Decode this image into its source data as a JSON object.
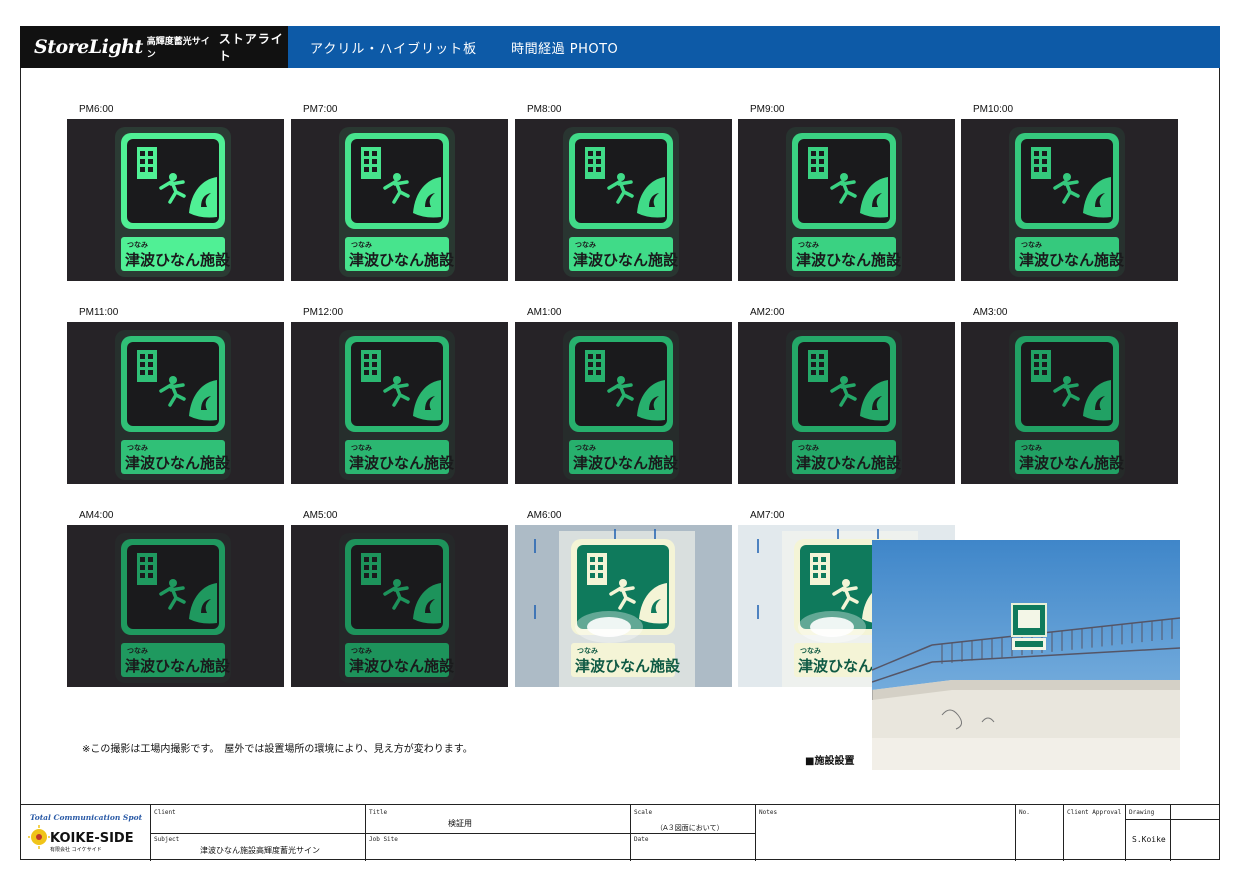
{
  "header": {
    "logo_en": "StoreLight",
    "logo_sub": "高輝度蓄光サイン",
    "logo_kana": "ストアライト",
    "title": "アクリル・ハイブリット板",
    "subtitle": "時間経過 PHOTO"
  },
  "sign": {
    "furigana": "つなみ",
    "text": "津波ひなん施設"
  },
  "photos": [
    {
      "label": "PM6:00",
      "brightness": 1.0,
      "scene": "night"
    },
    {
      "label": "PM7:00",
      "brightness": 0.92,
      "scene": "night"
    },
    {
      "label": "PM8:00",
      "brightness": 0.86,
      "scene": "night"
    },
    {
      "label": "PM9:00",
      "brightness": 0.8,
      "scene": "night"
    },
    {
      "label": "PM10:00",
      "brightness": 0.74,
      "scene": "night"
    },
    {
      "label": "PM11:00",
      "brightness": 0.68,
      "scene": "night"
    },
    {
      "label": "PM12:00",
      "brightness": 0.62,
      "scene": "night"
    },
    {
      "label": "AM1:00",
      "brightness": 0.57,
      "scene": "night"
    },
    {
      "label": "AM2:00",
      "brightness": 0.52,
      "scene": "night"
    },
    {
      "label": "AM3:00",
      "brightness": 0.47,
      "scene": "night"
    },
    {
      "label": "AM4:00",
      "brightness": 0.42,
      "scene": "night"
    },
    {
      "label": "AM5:00",
      "brightness": 0.38,
      "scene": "night"
    },
    {
      "label": "AM6:00",
      "brightness": 1.0,
      "scene": "day"
    },
    {
      "label": "AM7:00",
      "brightness": 1.0,
      "scene": "day-bright"
    }
  ],
  "note": "※この撮影は工場内撮影です。　屋外では設置場所の環境により、見え方が変わります。",
  "install_label": "■施設設置",
  "title_block": {
    "company_script": "Total Communication Spot",
    "company_name": "KOIKE-SIDE",
    "company_sub": "有限会社 コイケサイド",
    "client_label": "Client",
    "client_value": "",
    "title_label": "Title",
    "title_value": "検証用",
    "scale_label": "Scale",
    "scale_value": "（A３図面において）",
    "notes_label": "Notes",
    "no_label": "No.",
    "client_approval_label": "Client Approval",
    "drawing_label": "Drawing",
    "subject_label": "Subject",
    "subject_value": "津波ひなん施設高輝度蓄光サイン",
    "jobsite_label": "Job Site",
    "date_label": "Date",
    "drawn_by": "S.Koike"
  },
  "colors": {
    "header_blue": "#0d5aa7",
    "glow_green": "#3cf2a0",
    "sign_green": "#0f7a5c"
  }
}
